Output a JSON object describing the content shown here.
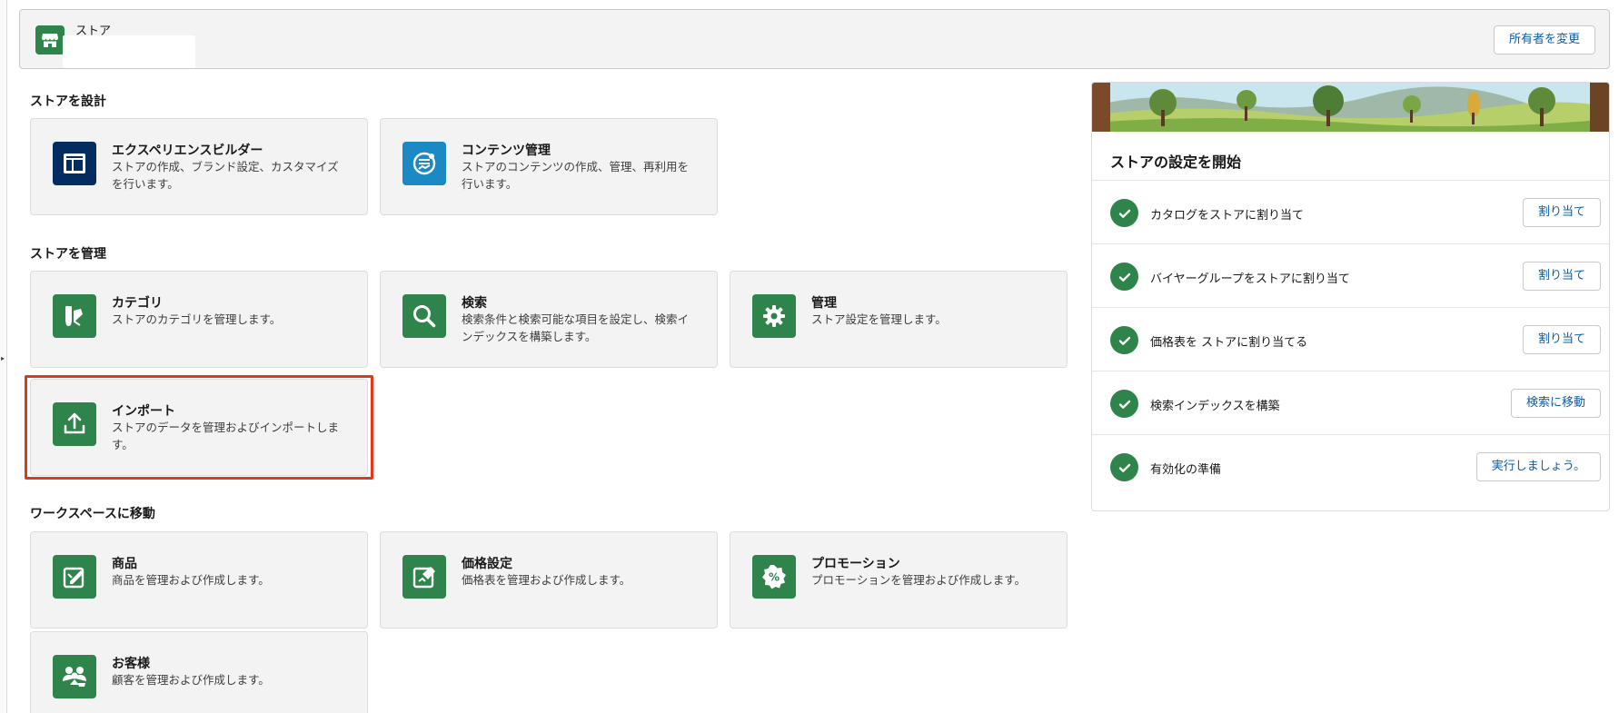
{
  "header": {
    "eyebrow": "ストア",
    "change_owner_label": "所有者を変更",
    "icon": "store-icon"
  },
  "design_section": {
    "title": "ストアを設計",
    "tiles": [
      {
        "title": "エクスペリエンスビルダー",
        "desc": "ストアの作成、ブランド設定、カスタマイズを行います。",
        "icon": "layout-icon"
      },
      {
        "title": "コンテンツ管理",
        "desc": "ストアのコンテンツの作成、管理、再利用を行います。",
        "icon": "content-icon"
      }
    ]
  },
  "manage_section": {
    "title": "ストアを管理",
    "tiles": [
      {
        "title": "カテゴリ",
        "desc": "ストアのカテゴリを管理します。",
        "icon": "category-icon"
      },
      {
        "title": "検索",
        "desc": "検索条件と検索可能な項目を設定し、検索インデックスを構築します。",
        "icon": "search-icon"
      },
      {
        "title": "管理",
        "desc": "ストア設定を管理します。",
        "icon": "gear-icon"
      },
      {
        "title": "インポート",
        "desc": "ストアのデータを管理およびインポートします。",
        "icon": "upload-icon"
      }
    ]
  },
  "workspace_section": {
    "title": "ワークスペースに移動",
    "tiles": [
      {
        "title": "商品",
        "desc": "商品を管理および作成します。",
        "icon": "product-icon"
      },
      {
        "title": "価格設定",
        "desc": "価格表を管理および作成します。",
        "icon": "price-tag-icon"
      },
      {
        "title": "プロモーション",
        "desc": "プロモーションを管理および作成します。",
        "icon": "percent-badge-icon"
      },
      {
        "title": "お客様",
        "desc": "顧客を管理および作成します。",
        "icon": "customers-icon"
      }
    ]
  },
  "setup": {
    "title": "ストアの設定を開始",
    "steps": [
      {
        "label": "カタログをストアに割り当て",
        "action": "割り当て"
      },
      {
        "label": "バイヤーグループをストアに割り当て",
        "action": "割り当て"
      },
      {
        "label": "価格表を ストアに割り当てる",
        "action": "割り当て"
      },
      {
        "label": "検索インデックスを構築",
        "action": "検索に移動"
      },
      {
        "label": "有効化の準備",
        "action": "実行しましょう。"
      }
    ]
  },
  "colors": {
    "accent_green": "#2e844a",
    "navy": "#032d60",
    "link_blue": "#0b5cab",
    "highlight_red": "#e8361a"
  }
}
